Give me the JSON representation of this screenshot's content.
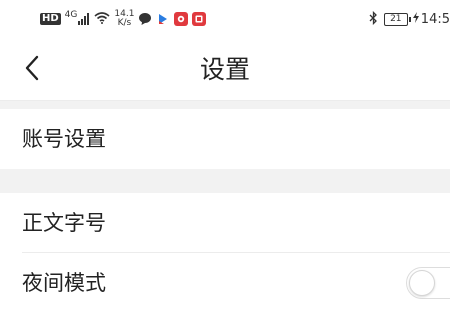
{
  "status_bar": {
    "hd": "HD",
    "network": "4G",
    "speed_value": "14.1",
    "speed_unit": "K/s",
    "battery": "21",
    "time": "14:5"
  },
  "header": {
    "back_icon": "chevron-left-icon",
    "title": "设置"
  },
  "settings": {
    "account": {
      "label": "账号设置"
    },
    "font_size": {
      "label": "正文字号"
    },
    "night_mode": {
      "label": "夜间模式",
      "enabled": false
    }
  },
  "colors": {
    "background": "#ffffff",
    "section_gap": "#f2f2f2",
    "divider": "#ececec",
    "text": "#222222"
  }
}
